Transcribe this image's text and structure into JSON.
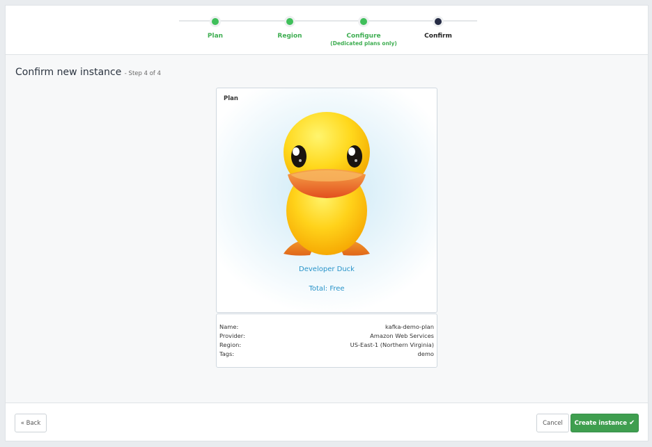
{
  "stepper": {
    "steps": [
      {
        "label": "Plan",
        "sublabel": ""
      },
      {
        "label": "Region",
        "sublabel": ""
      },
      {
        "label": "Configure",
        "sublabel": "(Dedicated plans only)"
      },
      {
        "label": "Confirm",
        "sublabel": ""
      }
    ],
    "colors": {
      "complete": "#3fbf5a",
      "current": "#262c45"
    }
  },
  "page": {
    "title": "Confirm new instance",
    "step_count": "- Step 4 of 4"
  },
  "plan_card": {
    "label": "Plan",
    "plan_name": "Developer Duck",
    "total": "Total: Free",
    "image": "duck-illustration"
  },
  "details": [
    {
      "key": "Name:",
      "value": "kafka-demo-plan"
    },
    {
      "key": "Provider:",
      "value": "Amazon Web Services"
    },
    {
      "key": "Region:",
      "value": "US-East-1 (Northern Virginia)"
    },
    {
      "key": "Tags:",
      "value": "demo"
    }
  ],
  "footer": {
    "back_label": "« Back",
    "cancel_label": "Cancel",
    "create_label": "Create instance",
    "create_icon": "check-icon",
    "create_color": "#3f9e4f"
  }
}
